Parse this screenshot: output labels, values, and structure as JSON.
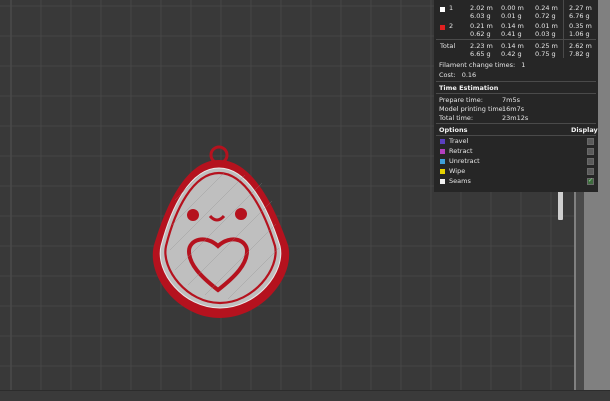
{
  "colors": {
    "viewport_bg": "#393939",
    "grid_line": "#4a4a4a",
    "model_red": "#b5121e",
    "model_gray": "#bfbfbf",
    "panel_bg": "#262626"
  },
  "filament_table": {
    "rows": [
      {
        "id": "1",
        "color": "#ffffff",
        "col1": [
          "2.02 m",
          "6.03 g"
        ],
        "col2": [
          "0.00 m",
          "0.01 g"
        ],
        "col3": [
          "0.24 m",
          "0.72 g"
        ],
        "col4": [
          "2.27 m",
          "6.76 g"
        ]
      },
      {
        "id": "2",
        "color": "#e02020",
        "col1": [
          "0.21 m",
          "0.62 g"
        ],
        "col2": [
          "0.14 m",
          "0.41 g"
        ],
        "col3": [
          "0.01 m",
          "0.03 g"
        ],
        "col4": [
          "0.35 m",
          "1.06 g"
        ]
      }
    ],
    "total": {
      "label": "Total",
      "col1": [
        "2.23 m",
        "6.65 g"
      ],
      "col2": [
        "0.14 m",
        "0.42 g"
      ],
      "col3": [
        "0.25 m",
        "0.75 g"
      ],
      "col4": [
        "2.62 m",
        "7.82 g"
      ]
    }
  },
  "filament_change": {
    "label": "Filament change times:",
    "value": "1"
  },
  "cost": {
    "label": "Cost:",
    "value": "0.16"
  },
  "time_estimation": {
    "title": "Time Estimation",
    "prepare": {
      "label": "Prepare time:",
      "value": "7m5s"
    },
    "model": {
      "label": "Model printing time:",
      "value": "16m7s"
    },
    "total": {
      "label": "Total time:",
      "value": "23m12s"
    }
  },
  "options": {
    "title": "Options",
    "display_label": "Display",
    "items": [
      {
        "label": "Travel",
        "color": "#5a3fbf",
        "checked": false
      },
      {
        "label": "Retract",
        "color": "#b33fbf",
        "checked": false
      },
      {
        "label": "Unretract",
        "color": "#3fa0d9",
        "checked": false
      },
      {
        "label": "Wipe",
        "color": "#e6d200",
        "checked": false
      },
      {
        "label": "Seams",
        "color": "#f0f0f0",
        "checked": true
      }
    ]
  }
}
